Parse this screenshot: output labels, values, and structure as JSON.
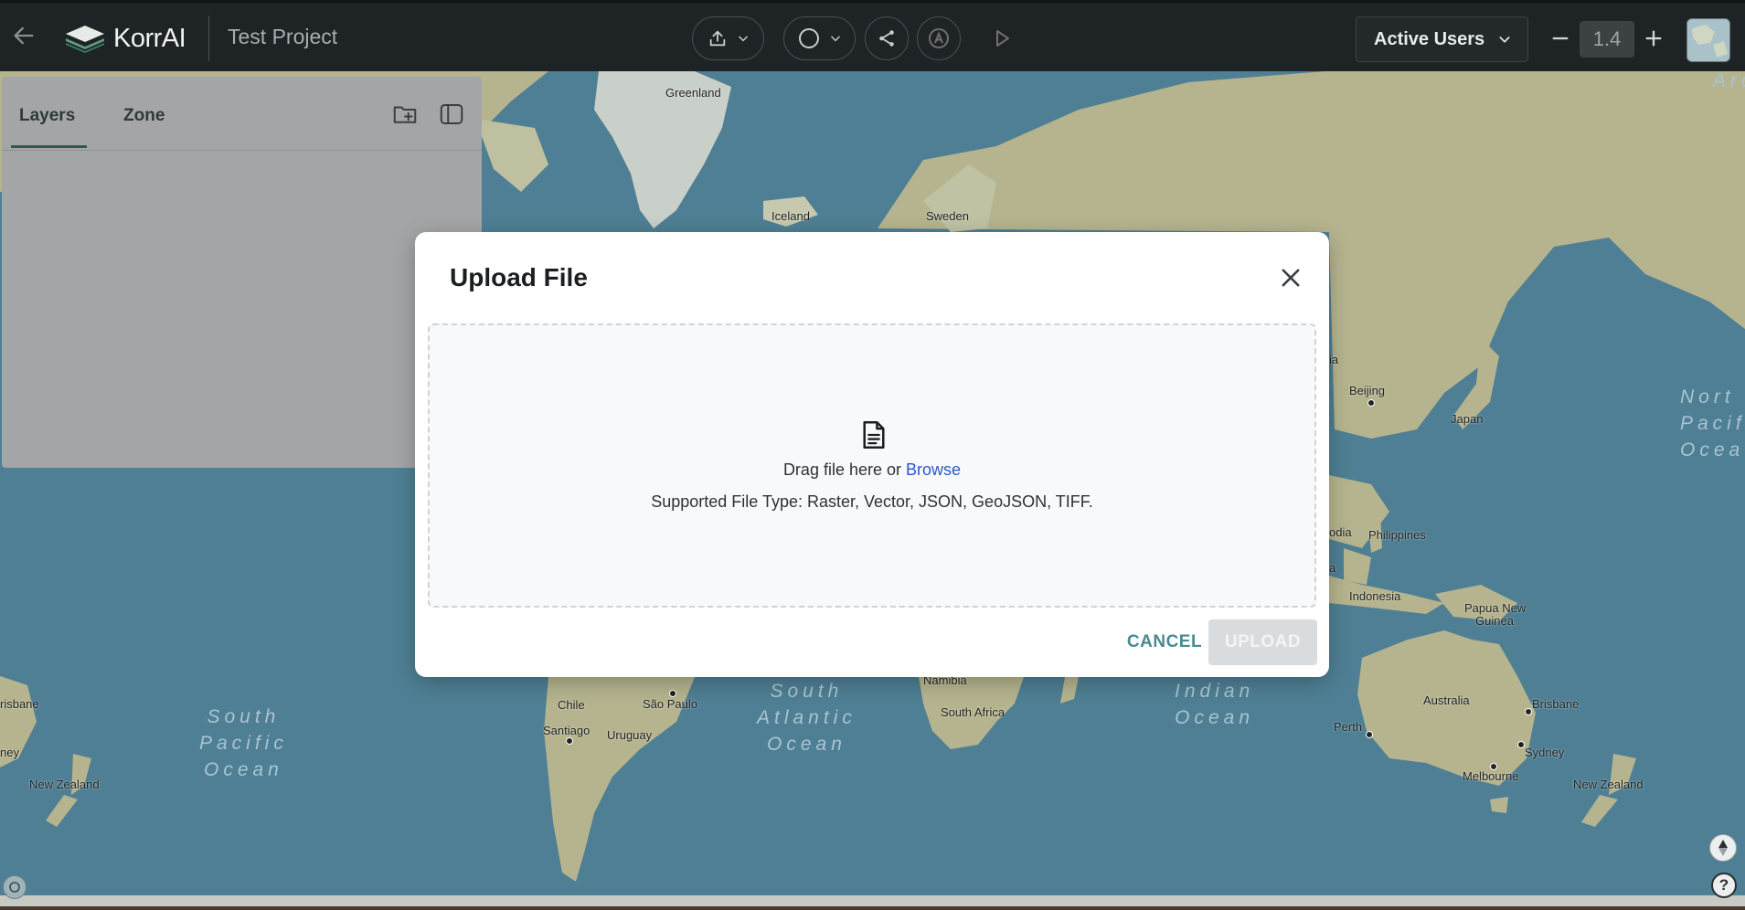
{
  "header": {
    "back_icon": "arrow-left-icon",
    "logo_text": "KorrAI",
    "project_title": "Test Project",
    "active_users_label": "Active Users",
    "zoom_value": "1.4"
  },
  "layers_panel": {
    "tabs": [
      {
        "label": "Layers",
        "active": true
      },
      {
        "label": "Zone",
        "active": false
      }
    ]
  },
  "map": {
    "labels": {
      "greenland": "Greenland",
      "iceland": "Iceland",
      "sweden": "Sweden",
      "beijing": "Beijing",
      "japan": "Japan",
      "philippines": "Philippines",
      "indonesia": "Indonesia",
      "papua": "Papua New",
      "guinea": "Guinea",
      "australia": "Australia",
      "brisbane_right": "Brisbane",
      "sydney": "Sydney",
      "melbourne": "Melbourne",
      "perth": "Perth",
      "nz_right": "New Zealand",
      "nz_left": "New Zealand",
      "brisbane_left": "risbane",
      "ney_left": "ney",
      "chile": "Chile",
      "santiago": "Santiago",
      "sao_paulo": "São Paulo",
      "uruguay": "Uruguay",
      "namibia": "Namibia",
      "south_africa": "South Africa",
      "ia_frag": "ia",
      "odia_frag": "odia",
      "a_frag": "a"
    },
    "oceans": {
      "south_pacific": "South\nPacific\nOcean",
      "south_atlantic": "South\nAtlantic\nOcean",
      "indian": "Indian\nOcean",
      "north_pacific": "Nort\nPacif\nOcea",
      "arc": "Arc"
    }
  },
  "modal": {
    "title": "Upload File",
    "drag_text": "Drag file here or",
    "browse_label": "Browse",
    "supported_text": "Supported File Type: Raster, Vector, JSON, GeoJSON, TIFF.",
    "cancel_label": "CANCEL",
    "upload_label": "UPLOAD"
  },
  "colors": {
    "ocean": "#4f7f94",
    "land": "#b5b48e",
    "topbar": "#1e2326",
    "accent": "#4a8a92",
    "link": "#2b58c9"
  }
}
